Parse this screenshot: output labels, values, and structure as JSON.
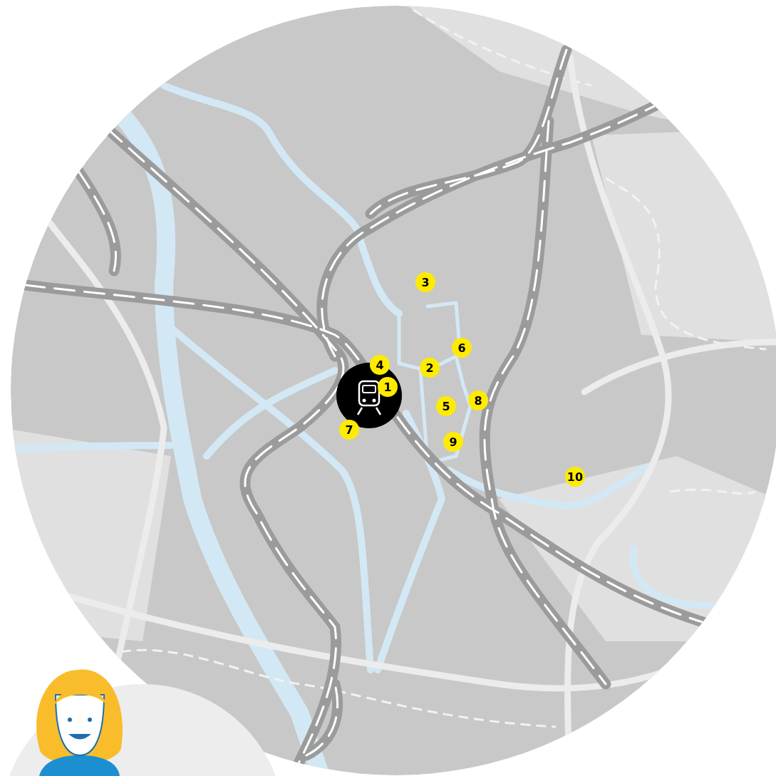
{
  "map": {
    "markers": [
      {
        "label": "1"
      },
      {
        "label": "2"
      },
      {
        "label": "3"
      },
      {
        "label": "4"
      },
      {
        "label": "5"
      },
      {
        "label": "6"
      },
      {
        "label": "7"
      },
      {
        "label": "8"
      },
      {
        "label": "9"
      },
      {
        "label": "10"
      }
    ]
  }
}
